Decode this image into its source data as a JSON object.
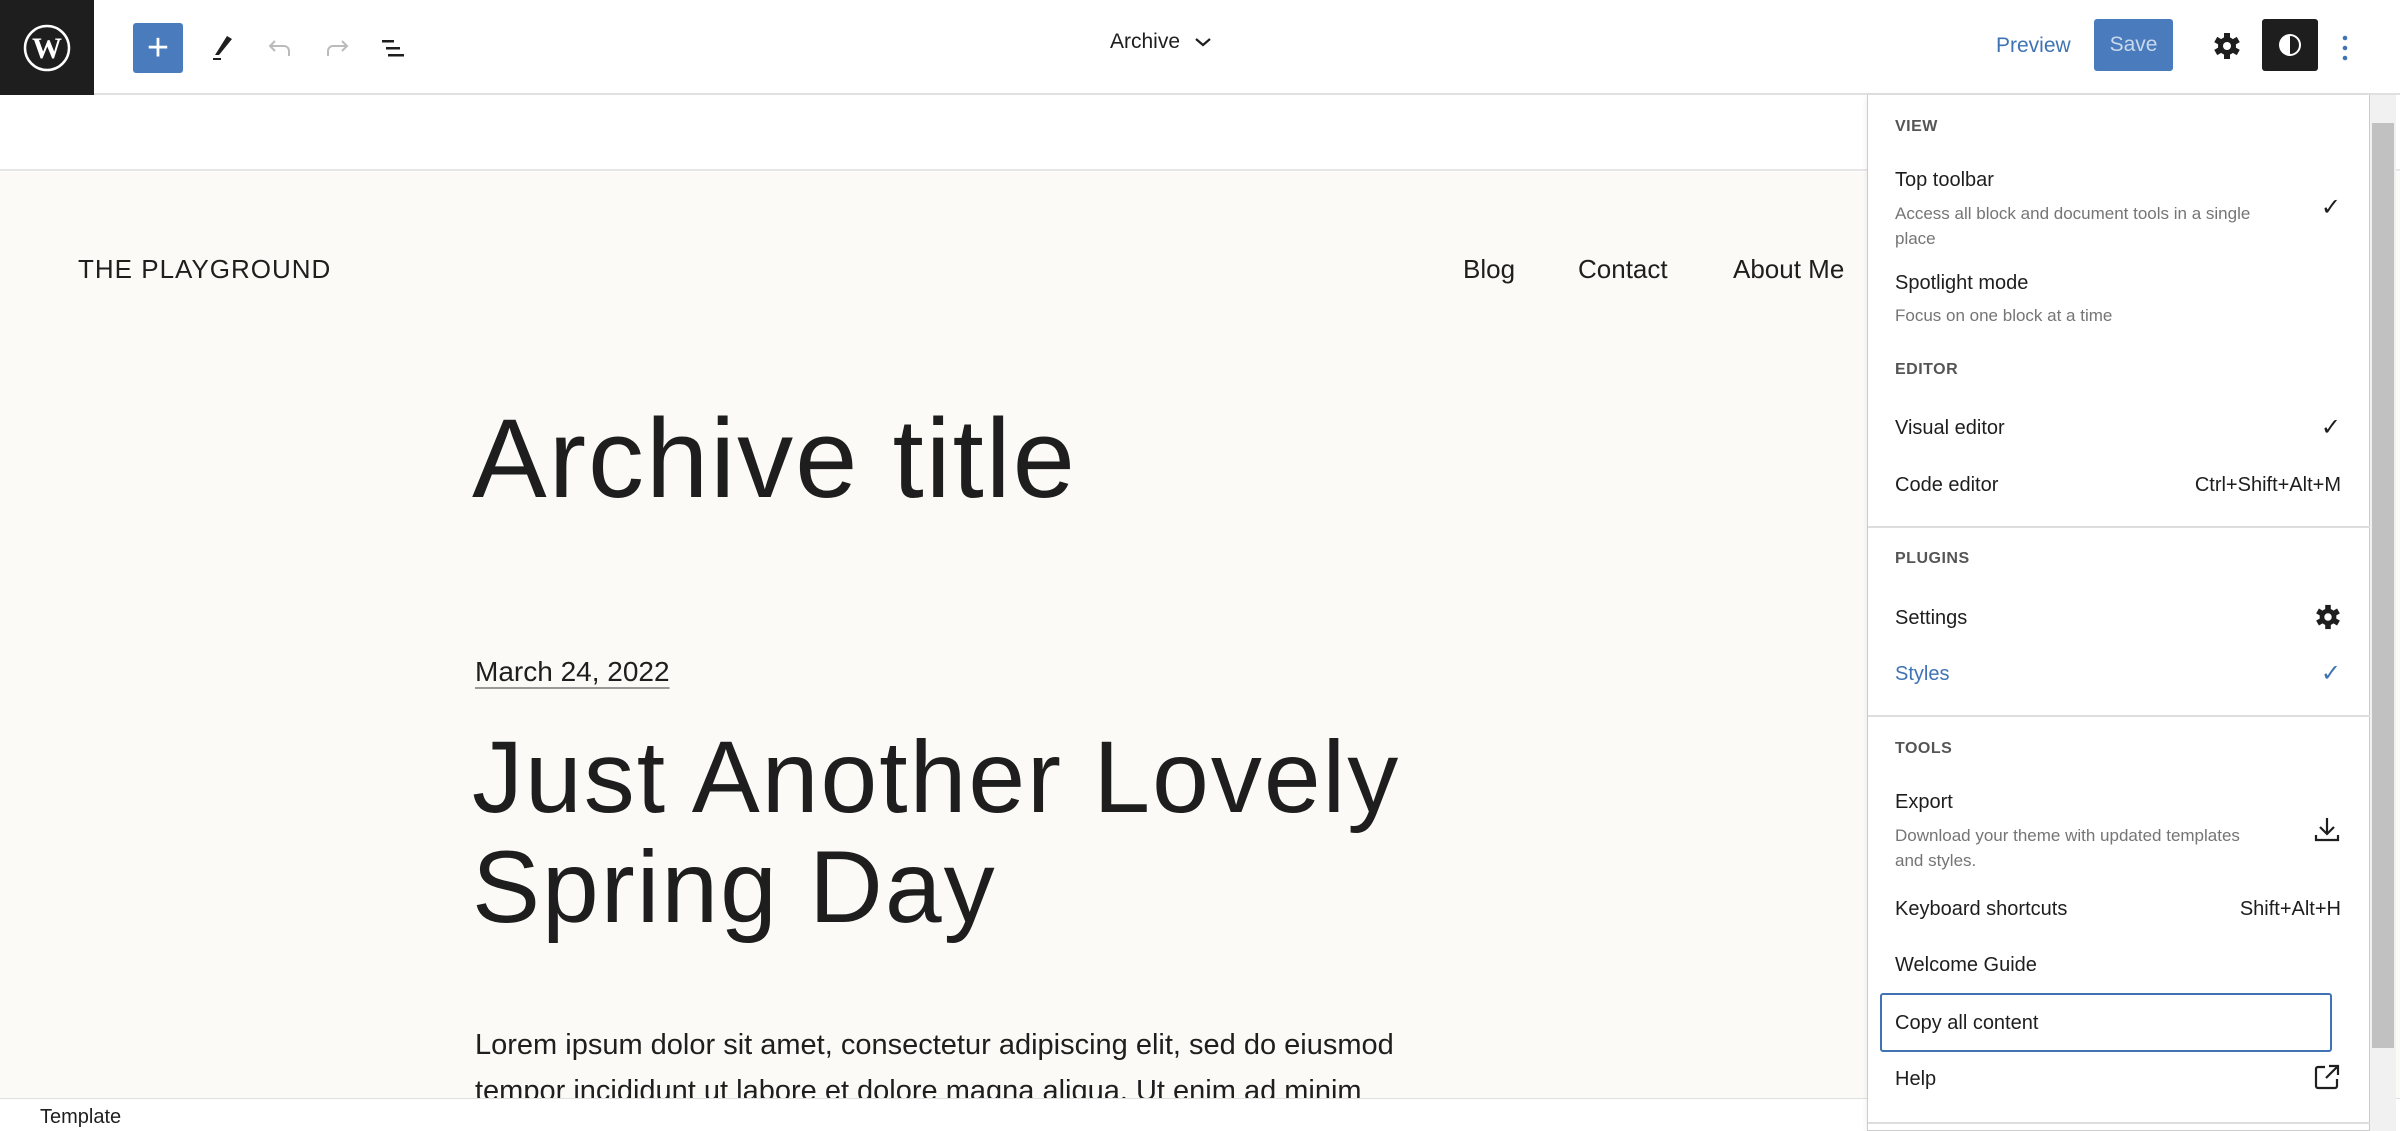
{
  "header": {
    "title": "Archive",
    "preview_label": "Preview",
    "save_label": "Save",
    "icons": [
      "wordpress-logo",
      "plus-icon",
      "pencil-icon",
      "undo-icon",
      "redo-icon",
      "list-view-icon",
      "chevron-down-icon",
      "gear-icon",
      "contrast-icon",
      "kebab-icon"
    ]
  },
  "site": {
    "title": "THE PLAYGROUND",
    "nav": [
      "Blog",
      "Contact",
      "About Me"
    ]
  },
  "content": {
    "archive_title": "Archive title",
    "post_date": "March 24, 2022",
    "post_title_line1": "Just Another Lovely",
    "post_title_line2": "Spring Day",
    "excerpt_line1": "Lorem ipsum dolor sit amet, consectetur adipiscing elit, sed do eiusmod",
    "excerpt_line2": "tempor incididunt ut labore et dolore magna aliqua. Ut enim ad minim"
  },
  "footer": {
    "label": "Template"
  },
  "menu": {
    "view": {
      "heading": "VIEW",
      "top_toolbar": "Top toolbar",
      "top_toolbar_desc": "Access all block and document tools in a single place",
      "top_toolbar_checked": true,
      "spotlight": "Spotlight mode",
      "spotlight_desc": "Focus on one block at a time",
      "spotlight_checked": false
    },
    "editor": {
      "heading": "EDITOR",
      "visual": "Visual editor",
      "visual_checked": true,
      "code": "Code editor",
      "code_shortcut": "Ctrl+Shift+Alt+M"
    },
    "plugins": {
      "heading": "PLUGINS",
      "settings": "Settings",
      "styles": "Styles",
      "styles_checked": true
    },
    "tools": {
      "heading": "TOOLS",
      "export": "Export",
      "export_desc": "Download your theme with updated templates and styles.",
      "shortcuts": "Keyboard shortcuts",
      "shortcuts_key": "Shift+Alt+H",
      "welcome": "Welcome Guide",
      "copy": "Copy all content",
      "help": "Help"
    }
  },
  "colors": {
    "accent": "#3f73b4",
    "button": "#4a7bbd",
    "dark": "#1e1e1e",
    "canvas": "#fbfaf7"
  }
}
